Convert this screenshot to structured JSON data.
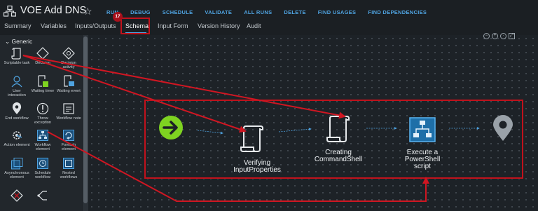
{
  "workflow": {
    "title": "VOE Add DNS"
  },
  "actions": [
    "RUN",
    "DEBUG",
    "SCHEDULE",
    "VALIDATE",
    "ALL RUNS",
    "DELETE",
    "FIND USAGES",
    "FIND DEPENDENCIES"
  ],
  "tabs": [
    "Summary",
    "Variables",
    "Inputs/Outputs",
    "Schema",
    "Input Form",
    "Version History",
    "Audit"
  ],
  "active_tab": "Schema",
  "annotation": {
    "step_badge": "17",
    "color": "#c1121c"
  },
  "palette": {
    "section": "Generic",
    "items": [
      {
        "label": "Scriptable task",
        "icon": "scriptable-task-icon"
      },
      {
        "label": "Decision",
        "icon": "decision-icon"
      },
      {
        "label": "Decision activity",
        "icon": "decision-activity-icon"
      },
      {
        "label": "User interaction",
        "icon": "user-interaction-icon"
      },
      {
        "label": "Waiting timer",
        "icon": "waiting-timer-icon"
      },
      {
        "label": "Waiting event",
        "icon": "waiting-event-icon"
      },
      {
        "label": "End workflow",
        "icon": "end-workflow-icon"
      },
      {
        "label": "Throw exception",
        "icon": "throw-exception-icon"
      },
      {
        "label": "Workflow note",
        "icon": "workflow-note-icon"
      },
      {
        "label": "Action element",
        "icon": "action-element-icon"
      },
      {
        "label": "Workflow element",
        "icon": "workflow-element-icon"
      },
      {
        "label": "Foreach element",
        "icon": "foreach-element-icon"
      },
      {
        "label": "Asynchronous element",
        "icon": "async-element-icon"
      },
      {
        "label": "Schedule workflow",
        "icon": "schedule-workflow-icon"
      },
      {
        "label": "Nested workflows",
        "icon": "nested-workflows-icon"
      }
    ]
  },
  "canvas": {
    "nodes": [
      {
        "label": "",
        "icon": "start-icon"
      },
      {
        "label": "Verifying InputProperties",
        "icon": "scriptable-task-icon"
      },
      {
        "label": "Creating CommandShell",
        "icon": "scriptable-task-icon"
      },
      {
        "label": "Execute a PowerShell script",
        "icon": "workflow-element-icon"
      },
      {
        "label": "",
        "icon": "end-icon"
      }
    ]
  },
  "colors": {
    "accent": "#4fa3e0",
    "start": "#7ed321",
    "annotation": "#c1121c"
  }
}
